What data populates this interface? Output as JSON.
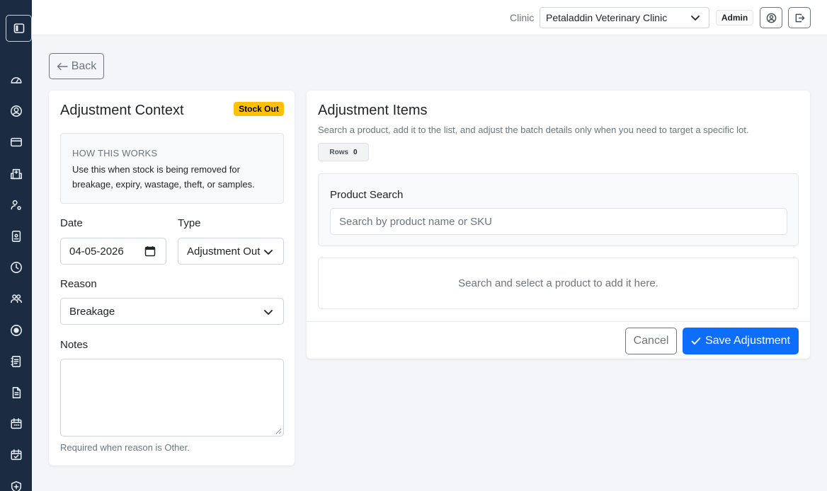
{
  "sidebar": {
    "toggle_icon": "sidebar-toggle-icon",
    "items": [
      {
        "icon": "dashboard-icon"
      },
      {
        "icon": "user-circle-icon"
      },
      {
        "icon": "credit-card-icon"
      },
      {
        "icon": "hospital-icon"
      },
      {
        "icon": "user-settings-icon"
      },
      {
        "icon": "id-badge-icon"
      },
      {
        "icon": "clock-icon"
      },
      {
        "icon": "people-icon"
      },
      {
        "icon": "record-circle-icon"
      },
      {
        "icon": "contacts-icon"
      },
      {
        "icon": "document-icon"
      },
      {
        "icon": "calendar-icon"
      },
      {
        "icon": "calendar-check-icon"
      },
      {
        "icon": "shield-plus-icon"
      }
    ]
  },
  "topbar": {
    "clinic_label": "Clinic",
    "clinic_selected": "Petaladdin Veterinary Clinic",
    "role_badge": "Admin",
    "profile_icon": "user-circle-icon",
    "logout_icon": "logout-icon"
  },
  "back_label": "Back",
  "context": {
    "title": "Adjustment Context",
    "status_badge": "Stock Out",
    "status_color": "#ffc107",
    "how_title": "HOW THIS WORKS",
    "how_text": "Use this when stock is being removed for breakage, expiry, wastage, theft, or samples.",
    "date_label": "Date",
    "date_value": "04-05-2026",
    "type_label": "Type",
    "type_value": "Adjustment Out",
    "reason_label": "Reason",
    "reason_value": "Breakage",
    "notes_label": "Notes",
    "notes_value": "",
    "notes_help": "Required when reason is Other."
  },
  "items": {
    "title": "Adjustment Items",
    "subtitle": "Search a product, add it to the list, and adjust the batch details only when you need to target a specific lot.",
    "rows_label": "Rows",
    "rows_count": "0",
    "search_label": "Product Search",
    "search_placeholder": "Search by product name or SKU",
    "empty_text": "Search and select a product to add it here.",
    "cancel_label": "Cancel",
    "save_label": "Save Adjustment",
    "primary_color": "#0d6efd"
  }
}
